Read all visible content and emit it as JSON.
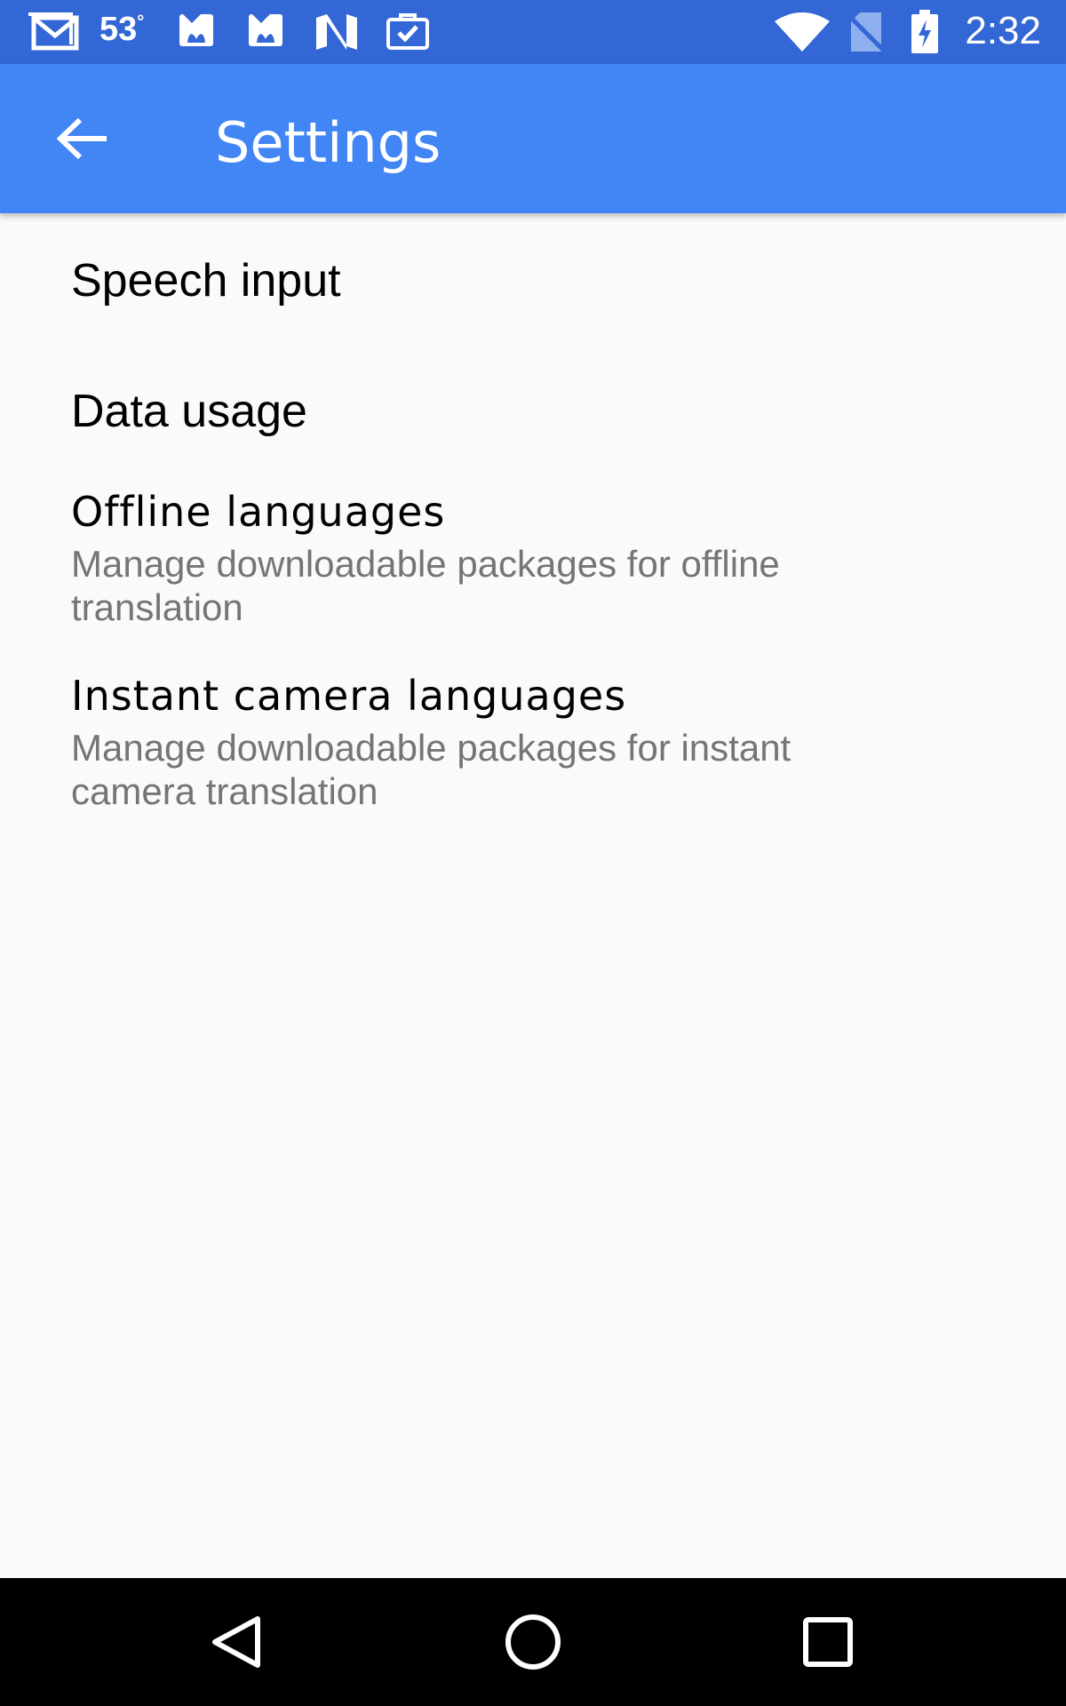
{
  "status_bar": {
    "temperature": "53",
    "degree": "°",
    "time": "2:32",
    "icons_left": [
      "gmail-icon",
      "weather-icon",
      "huawei-icon",
      "huawei-icon",
      "n-app-icon",
      "briefcase-check-icon"
    ],
    "icons_right": [
      "wifi-icon",
      "no-sim-icon",
      "battery-charging-icon"
    ]
  },
  "app_bar": {
    "title": "Settings",
    "back_icon": "arrow-back-icon",
    "color": "#4285f4"
  },
  "settings": [
    {
      "title": "Speech input",
      "summary": ""
    },
    {
      "title": "Data usage",
      "summary": ""
    },
    {
      "title": "Offline languages",
      "summary": "Manage downloadable packages for offline translation"
    },
    {
      "title": "Instant camera languages",
      "summary": "Manage downloadable packages for instant camera translation"
    }
  ],
  "nav_bar": {
    "back": "nav-back-icon",
    "home": "nav-home-icon",
    "recents": "nav-recents-icon"
  }
}
